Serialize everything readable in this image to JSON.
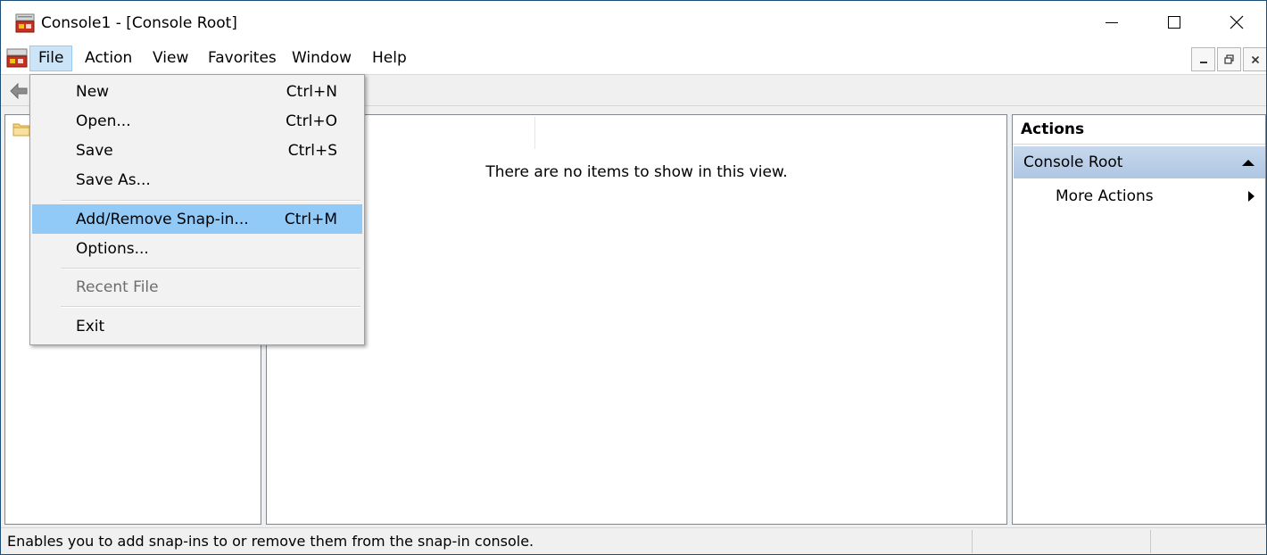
{
  "window": {
    "title": "Console1 - [Console Root]",
    "icon": "mmc-console-icon"
  },
  "menubar": {
    "items": [
      {
        "label": "File",
        "active": true
      },
      {
        "label": "Action"
      },
      {
        "label": "View"
      },
      {
        "label": "Favorites"
      },
      {
        "label": "Window"
      },
      {
        "label": "Help"
      }
    ]
  },
  "file_menu": {
    "items": [
      {
        "label": "New",
        "shortcut": "Ctrl+N"
      },
      {
        "label": "Open...",
        "shortcut": "Ctrl+O"
      },
      {
        "label": "Save",
        "shortcut": "Ctrl+S"
      },
      {
        "label": "Save As...",
        "shortcut": ""
      },
      {
        "label": "Add/Remove Snap-in...",
        "shortcut": "Ctrl+M",
        "highlighted": true
      },
      {
        "label": "Options...",
        "shortcut": ""
      },
      {
        "label": "Recent File",
        "shortcut": "",
        "disabled": true
      },
      {
        "label": "Exit",
        "shortcut": ""
      }
    ]
  },
  "result_pane": {
    "empty_message": "There are no items to show in this view."
  },
  "actions_pane": {
    "header": "Actions",
    "section": "Console Root",
    "items": [
      {
        "label": "More Actions"
      }
    ]
  },
  "statusbar": {
    "text": "Enables you to add snap-ins to or remove them from the snap-in console."
  },
  "colors": {
    "menu_highlight": "#91c9f7",
    "active_menu_bg": "#cce4f7",
    "actions_section_bg": "#b9cfe8",
    "window_border": "#1f4e79"
  }
}
